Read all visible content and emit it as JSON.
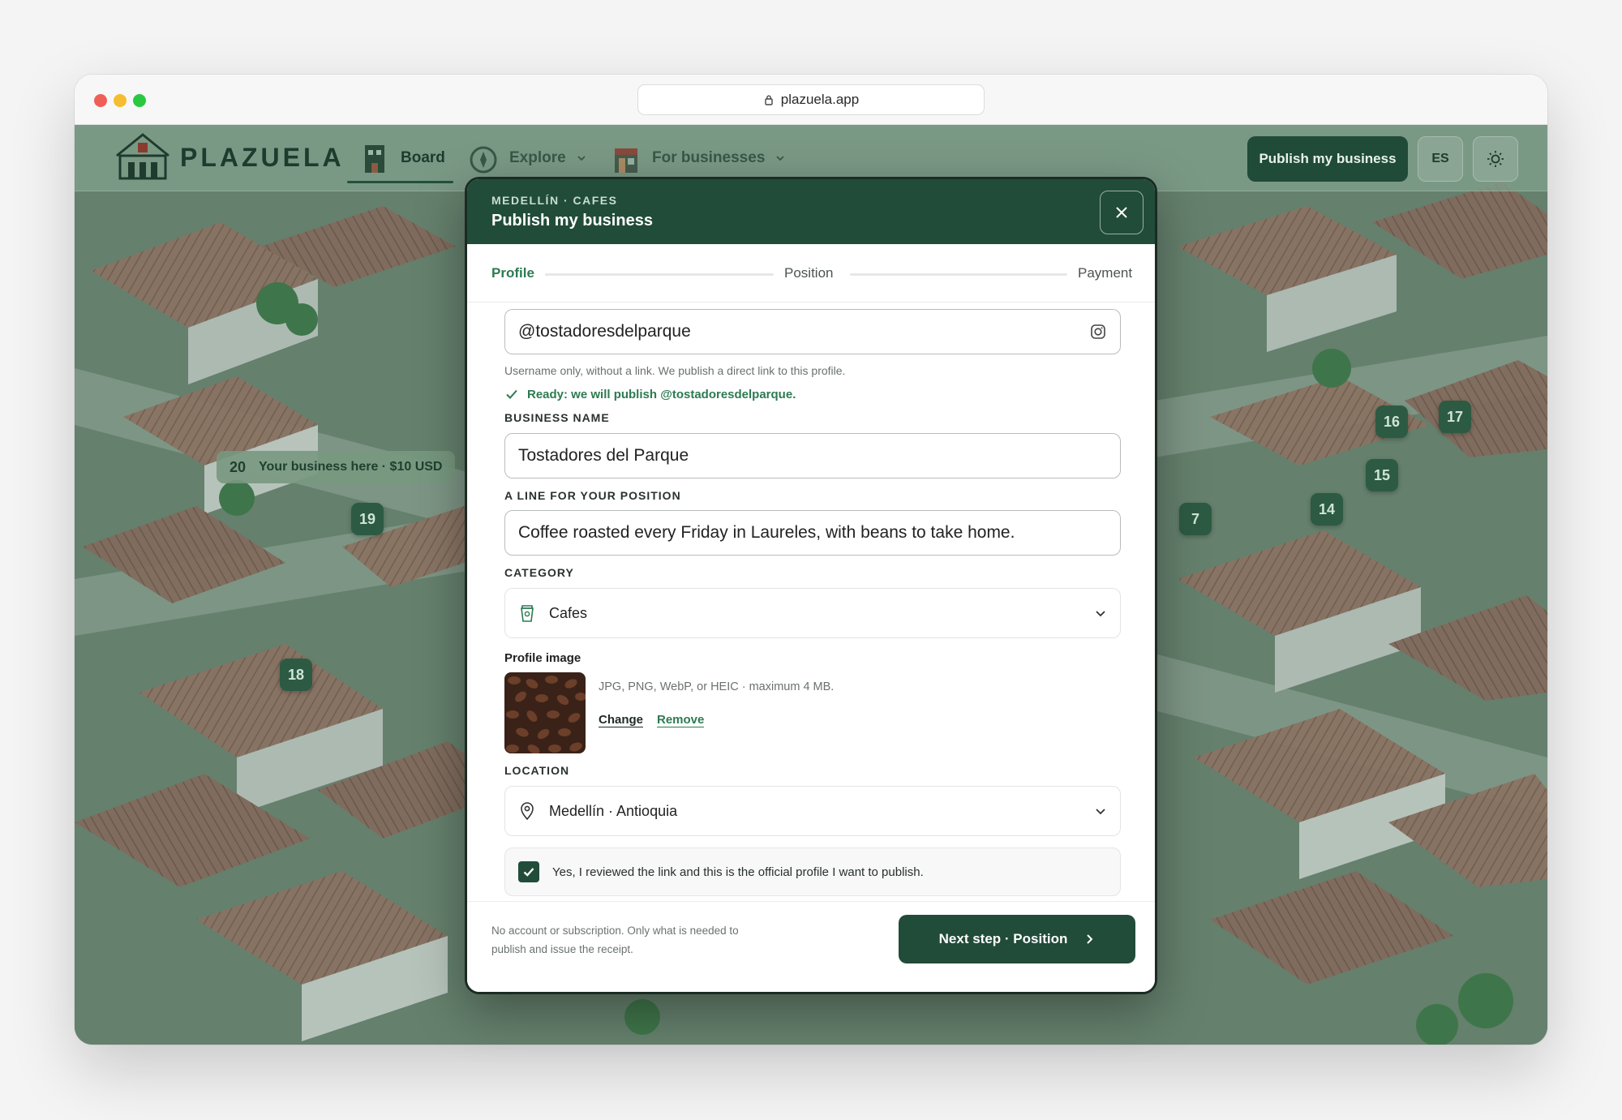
{
  "browser": {
    "url": "plazuela.app"
  },
  "nav": {
    "logo": "PLAZUELA",
    "items": [
      {
        "label": "Board",
        "icon": "building-icon"
      },
      {
        "label": "Explore",
        "icon": "compass-icon"
      },
      {
        "label": "For businesses",
        "icon": "storefront-icon"
      }
    ],
    "publish_button": "Publish my business",
    "language": "ES"
  },
  "map": {
    "pins": [
      "16",
      "17",
      "15",
      "14",
      "7",
      "19",
      "18"
    ],
    "featured_pin": {
      "number": "20",
      "label": "Your business here · $10 USD"
    }
  },
  "modal": {
    "eyebrow": "MEDELLÍN · CAFES",
    "title": "Publish my business",
    "steps": [
      "Profile",
      "Position",
      "Payment"
    ],
    "current_step": "Profile",
    "instagram": {
      "value": "@tostadoresdelparque",
      "helper": "Username only, without a link. We publish a direct link to this profile.",
      "status": "Ready: we will publish @tostadoresdelparque."
    },
    "business_name": {
      "label": "BUSINESS NAME",
      "value": "Tostadores del Parque"
    },
    "position_line": {
      "label": "A LINE FOR YOUR POSITION",
      "value": "Coffee roasted every Friday in Laureles, with beans to take home."
    },
    "category": {
      "label": "CATEGORY",
      "value": "Cafes",
      "icon": "coffee-cup-icon"
    },
    "profile_image": {
      "label": "Profile image",
      "info": "JPG, PNG, WebP, or HEIC · maximum 4 MB.",
      "change": "Change",
      "remove": "Remove"
    },
    "location": {
      "label": "LOCATION",
      "value": "Medellín · Antioquia",
      "icon": "map-pin-icon"
    },
    "confirmation": {
      "text": "Yes, I reviewed the link and this is the official profile I want to publish.",
      "checked": true
    },
    "footer": {
      "note": "No account or subscription. Only what is needed to publish and issue the receipt.",
      "next_button": "Next step · Position"
    }
  },
  "map_toolbar": [
    "rotate-left-icon",
    "rotate-right-icon",
    "zoom-in-icon",
    "zoom-out-icon",
    "swap-icon",
    "walk-icon",
    "home-icon"
  ],
  "colors": {
    "brand": "#214c39",
    "accent": "#2d7a52",
    "map": "#6f8a78"
  }
}
